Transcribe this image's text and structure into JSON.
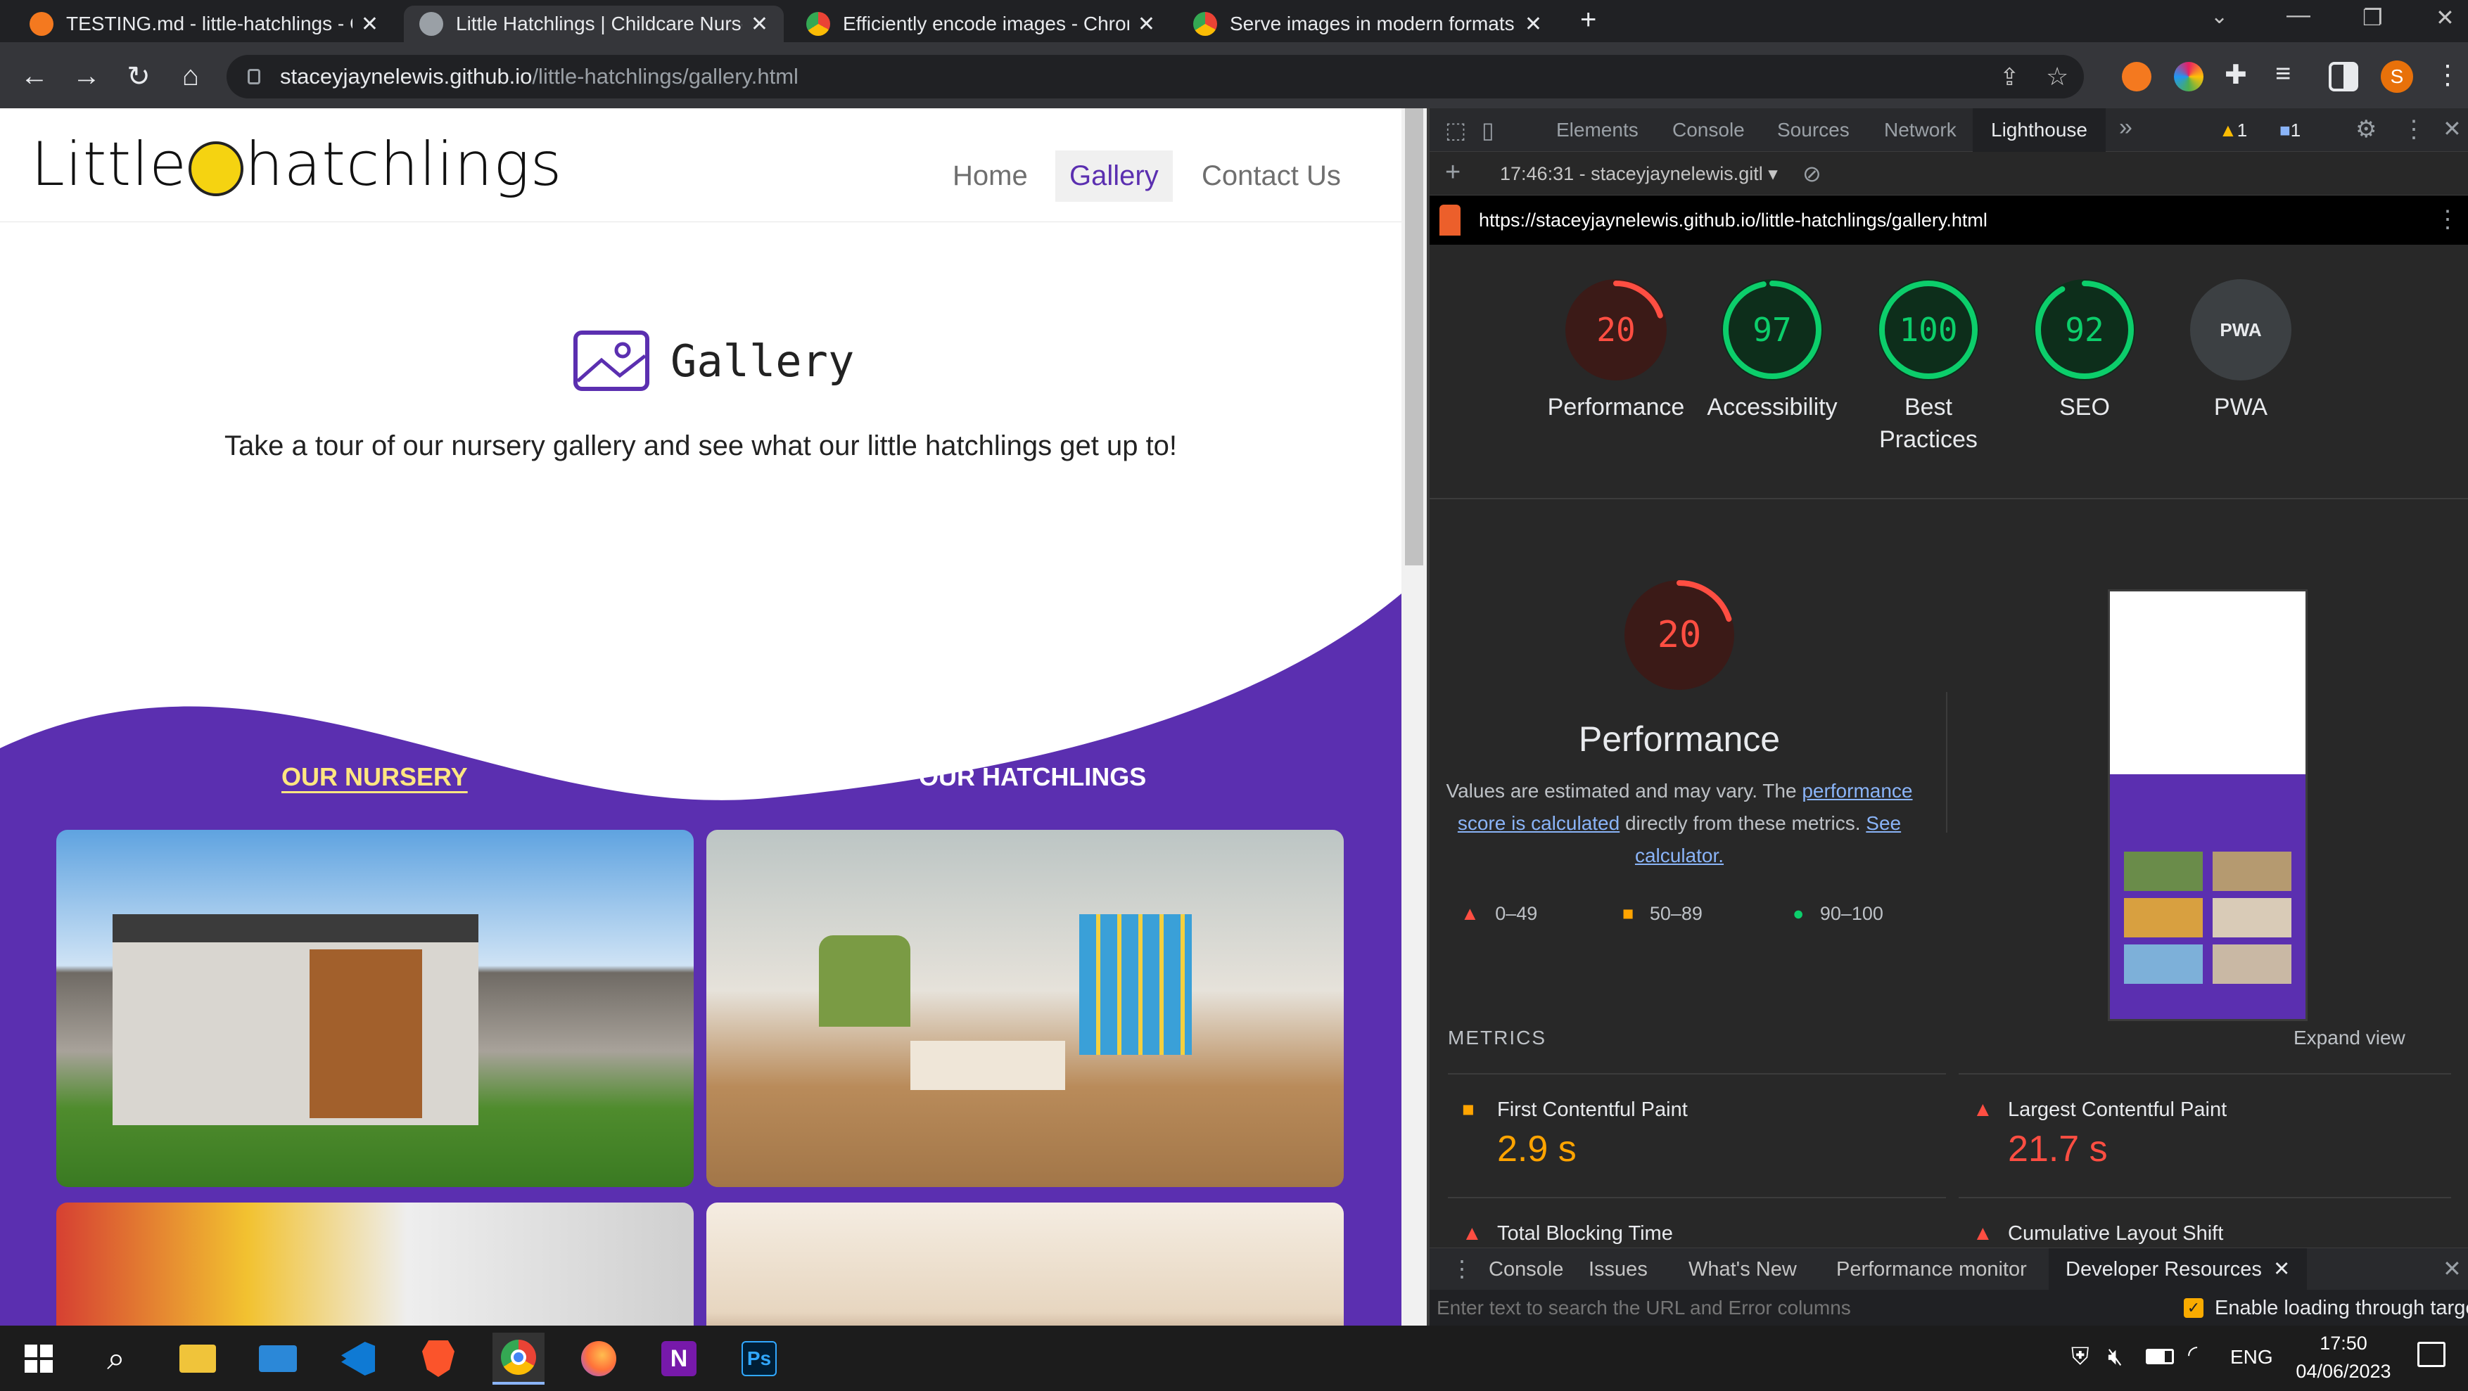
{
  "browser": {
    "tabs": [
      {
        "title": "TESTING.md - little-hatchlings - G",
        "favicon_color": "#f4791f",
        "active": false
      },
      {
        "title": "Little Hatchlings | Childcare Nurse",
        "favicon_color": "#9aa0a6",
        "active": true
      },
      {
        "title": "Efficiently encode images - Chron",
        "favicon_color": "#4285f4",
        "active": false
      },
      {
        "title": "Serve images in modern formats",
        "favicon_color": "#4285f4",
        "active": false
      }
    ],
    "url_host": "staceyjaynelewis.github.io",
    "url_path": "/little-hatchlings/gallery.html",
    "profile_initial": "S"
  },
  "site": {
    "logo_left": "Little",
    "logo_right": "hatchlings",
    "nav": [
      "Home",
      "Gallery",
      "Contact Us"
    ],
    "selected_nav": "Gallery",
    "gallery_title": "Gallery",
    "gallery_subtitle": "Take a tour of our nursery gallery and see what our little hatchlings get up to!",
    "col_nursery": "OUR NURSERY",
    "col_hatchlings": "OUR HATCHLINGS",
    "accent": "#5b2fb0"
  },
  "devtools": {
    "tabs": [
      "Elements",
      "Console",
      "Sources",
      "Network",
      "Lighthouse"
    ],
    "selected_tab": "Lighthouse",
    "warnings": "1",
    "messages": "1",
    "report_time": "17:46:31 - staceyjaynelewis.gitl",
    "report_url": "https://staceyjaynelewis.github.io/little-hatchlings/gallery.html",
    "scores": [
      {
        "label": "Performance",
        "value": "20",
        "color": "#ff4e42",
        "fill": 0.2
      },
      {
        "label": "Accessibility",
        "value": "97",
        "color": "#0cce6b",
        "fill": 0.97
      },
      {
        "label": "Best Practices",
        "value": "100",
        "color": "#0cce6b",
        "fill": 1.0
      },
      {
        "label": "SEO",
        "value": "92",
        "color": "#0cce6b",
        "fill": 0.92
      },
      {
        "label": "PWA",
        "value": "PWA",
        "color": "#9aa0a6",
        "fill": 0
      }
    ],
    "perf_title": "Performance",
    "perf_score": "20",
    "perf_note_1": "Values are estimated and may vary. The ",
    "perf_link_1": "performance score is calculated",
    "perf_note_2": " directly from these metrics. ",
    "perf_link_2": "See calculator.",
    "legend": [
      "0–49",
      "50–89",
      "90–100"
    ],
    "metrics_heading": "METRICS",
    "expand_view": "Expand view",
    "metrics": [
      {
        "label": "First Contentful Paint",
        "value": "2.9 s",
        "color": "#ffa400"
      },
      {
        "label": "Largest Contentful Paint",
        "value": "21.7 s",
        "color": "#ff4e42"
      },
      {
        "label": "Total Blocking Time",
        "value": "",
        "color": "#ff4e42"
      },
      {
        "label": "Cumulative Layout Shift",
        "value": "",
        "color": "#ff4e42"
      }
    ],
    "drawer_tabs": [
      "Console",
      "Issues",
      "What's New",
      "Performance monitor",
      "Developer Resources"
    ],
    "drawer_selected": "Developer Resources",
    "filter_placeholder": "Enter text to search the URL and Error columns",
    "enable_loading": "Enable loading through targe"
  },
  "taskbar": {
    "language": "ENG",
    "time": "17:50",
    "date": "04/06/2023"
  }
}
